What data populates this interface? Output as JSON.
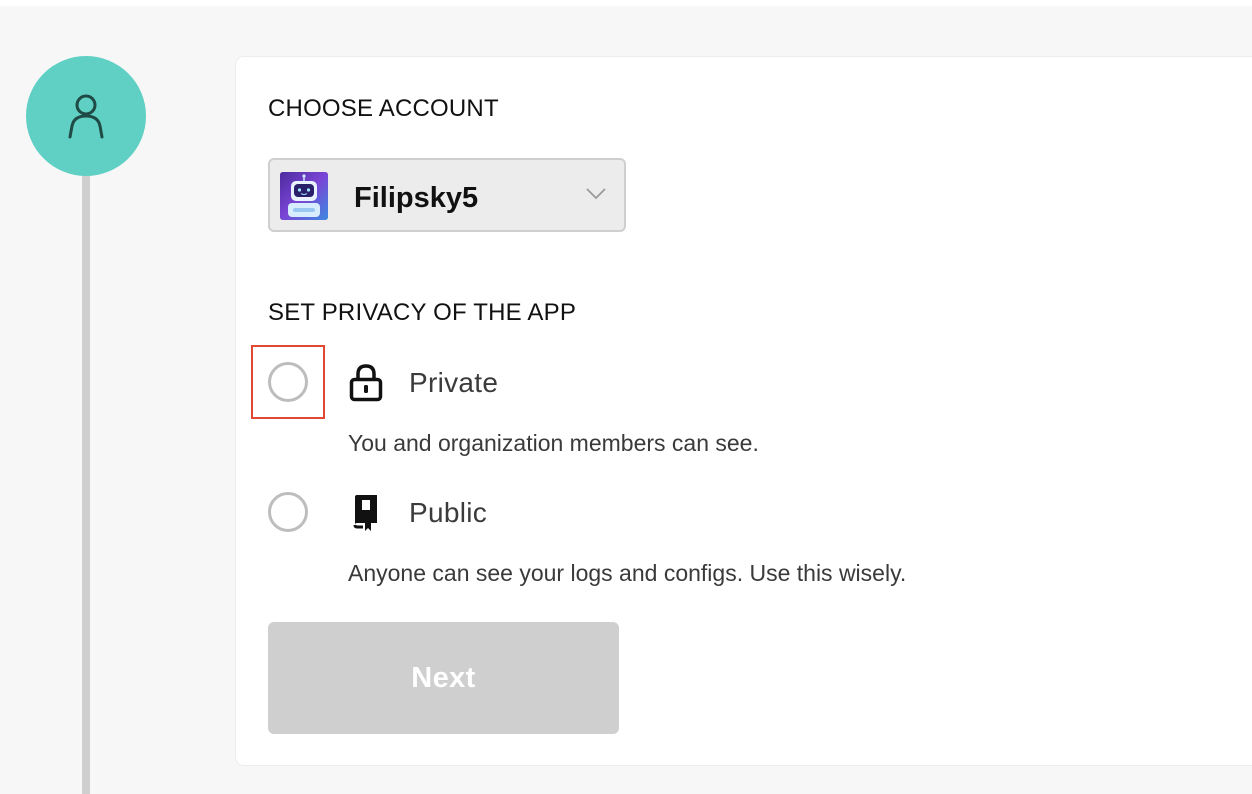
{
  "stepper": {
    "step_icon": "user-icon",
    "accent_color": "#5fd0c3"
  },
  "account": {
    "section_title": "CHOOSE ACCOUNT",
    "selected_account": "Filipsky5",
    "avatar_icon": "robot-avatar",
    "dropdown_icon": "chevron-down-icon"
  },
  "privacy": {
    "section_title": "SET PRIVACY OF THE APP",
    "options": [
      {
        "label": "Private",
        "description": "You and organization members can see.",
        "icon": "lock-icon",
        "selected": false
      },
      {
        "label": "Public",
        "description": "Anyone can see your logs and configs. Use this wisely.",
        "icon": "book-icon",
        "selected": false
      }
    ],
    "highlight_color": "#e04a35"
  },
  "actions": {
    "next_label": "Next",
    "next_disabled": true
  }
}
